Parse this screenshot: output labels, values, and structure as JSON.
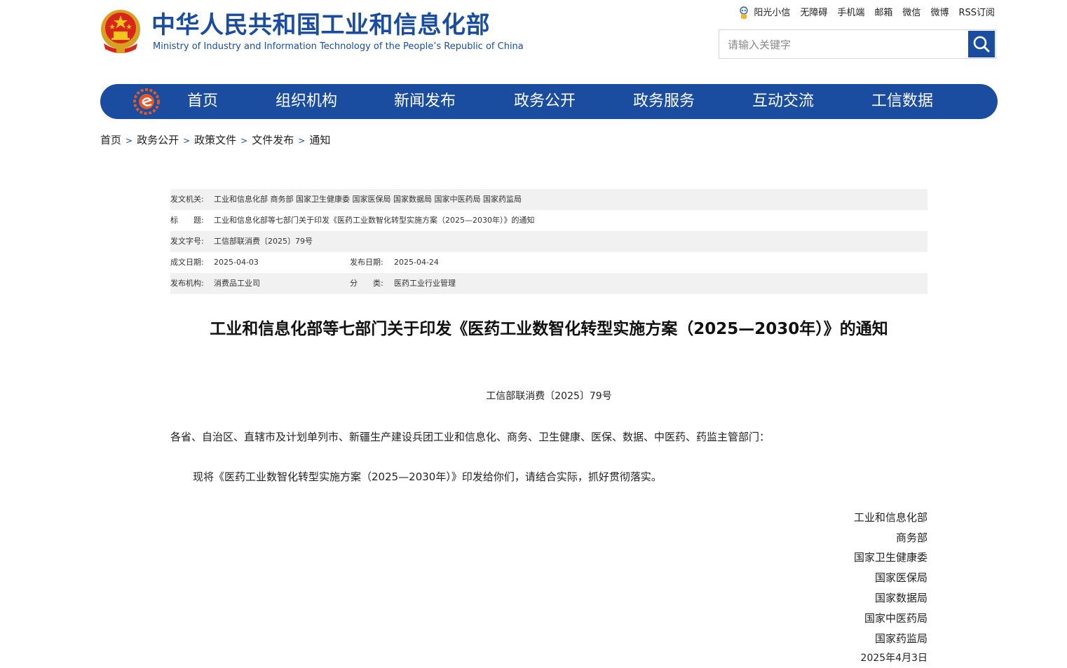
{
  "header": {
    "org_name_cn": "中华人民共和国工业和信息化部",
    "org_name_en": "Ministry of Industry and Information Technology of the People’s Republic of China",
    "top_links": [
      "阳光小信",
      "无障碍",
      "手机端",
      "邮箱",
      "微信",
      "微博",
      "RSS订阅"
    ],
    "search_placeholder": "请输入关键字"
  },
  "nav": {
    "items": [
      "首页",
      "组织机构",
      "新闻发布",
      "政务公开",
      "政务服务",
      "互动交流",
      "工信数据"
    ]
  },
  "breadcrumb": [
    "首页",
    "政务公开",
    "政策文件",
    "文件发布",
    "通知"
  ],
  "meta": {
    "issuer_label": "发文机关:",
    "issuer_value": "工业和信息化部 商务部 国家卫生健康委 国家医保局 国家数据局 国家中医药局 国家药监局",
    "title_label": "标　　题:",
    "title_value": "工业和信息化部等七部门关于印发《医药工业数智化转型实施方案（2025—2030年）》的通知",
    "docno_label": "发文字号:",
    "docno_value": "工信部联消费〔2025〕79号",
    "written_label": "成文日期:",
    "written_value": "2025-04-03",
    "published_label": "发布日期:",
    "published_value": "2025-04-24",
    "agency_label": "发布机构:",
    "agency_value": "消费品工业司",
    "category_label": "分　　类:",
    "category_value": "医药工业行业管理"
  },
  "article": {
    "title": "工业和信息化部等七部门关于印发《医药工业数智化转型实施方案（2025—2030年）》的通知",
    "doc_number": "工信部联消费〔2025〕79号",
    "salutation": "各省、自治区、直辖市及计划单列市、新疆生产建设兵团工业和信息化、商务、卫生健康、医保、数据、中医药、药监主管部门：",
    "body": "现将《医药工业数智化转型实施方案（2025—2030年）》印发给你们，请结合实际，抓好贯彻落实。",
    "signatories": [
      "工业和信息化部",
      "商务部",
      "国家卫生健康委",
      "国家医保局",
      "国家数据局",
      "国家中医药局",
      "国家药监局"
    ],
    "date": "2025年4月3日"
  },
  "colors": {
    "brand_blue": "#1a4da0",
    "meta_shade": "#f1f1f1"
  }
}
